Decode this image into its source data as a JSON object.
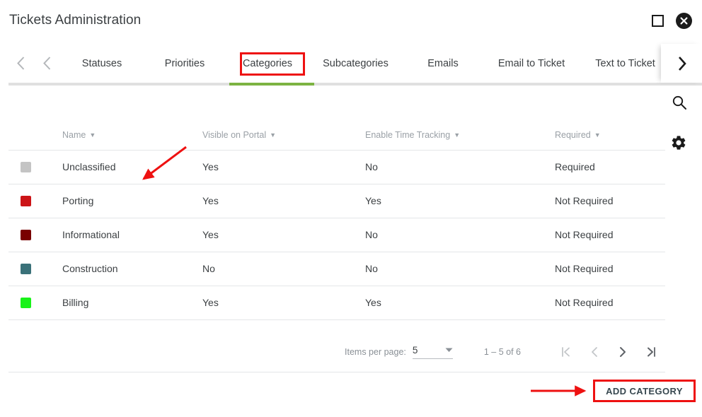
{
  "window": {
    "title": "Tickets Administration",
    "maximize_icon": "square-outline-icon",
    "close_icon": "close-circle-icon"
  },
  "tabbar": {
    "prev_icon_1": "chevron-left-icon",
    "prev_icon_2": "chevron-left-icon",
    "next_icon": "chevron-right-icon",
    "active_tab": "Categories",
    "active_underline_color": "#7cb342",
    "highlight_color": "#ee1111",
    "tabs": [
      {
        "label": "Statuses"
      },
      {
        "label": "Priorities"
      },
      {
        "label": "Categories"
      },
      {
        "label": "Subcategories"
      },
      {
        "label": "Emails"
      },
      {
        "label": "Email to Ticket"
      },
      {
        "label": "Text to Ticket"
      }
    ]
  },
  "toolbar": {
    "search_icon": "search-icon",
    "settings_icon": "gear-icon"
  },
  "table": {
    "columns": [
      {
        "key": "swatch",
        "label": ""
      },
      {
        "key": "name",
        "label": "Name",
        "sortable": true
      },
      {
        "key": "visible",
        "label": "Visible on Portal",
        "sortable": true
      },
      {
        "key": "timetracking",
        "label": "Enable Time Tracking",
        "sortable": true
      },
      {
        "key": "required",
        "label": "Required",
        "sortable": true
      }
    ],
    "sort_caret": "▼",
    "rows": [
      {
        "color": "#c4c4c4",
        "name": "Unclassified",
        "visible": "Yes",
        "timetracking": "No",
        "required": "Required"
      },
      {
        "color": "#cc1417",
        "name": "Porting",
        "visible": "Yes",
        "timetracking": "Yes",
        "required": "Not Required"
      },
      {
        "color": "#790000",
        "name": "Informational",
        "visible": "Yes",
        "timetracking": "No",
        "required": "Not Required"
      },
      {
        "color": "#3a7179",
        "name": "Construction",
        "visible": "No",
        "timetracking": "No",
        "required": "Not Required"
      },
      {
        "color": "#19f219",
        "name": "Billing",
        "visible": "Yes",
        "timetracking": "Yes",
        "required": "Not Required"
      }
    ]
  },
  "paginator": {
    "items_per_page_label": "Items per page:",
    "items_per_page_value": "5",
    "dropdown_icon": "chevron-down-icon",
    "range_label": "1 – 5 of 6",
    "first_page_icon": "first-page-icon",
    "prev_page_icon": "chevron-left-icon",
    "next_page_icon": "chevron-right-icon",
    "last_page_icon": "last-page-icon"
  },
  "actions": {
    "add_category_label": "ADD CATEGORY"
  },
  "annotations": {
    "color": "#ee1111",
    "arrow_to_table": "red-arrow-pointing-to-first-row",
    "arrow_to_add_category": "red-arrow-pointing-to-add-category-button"
  }
}
